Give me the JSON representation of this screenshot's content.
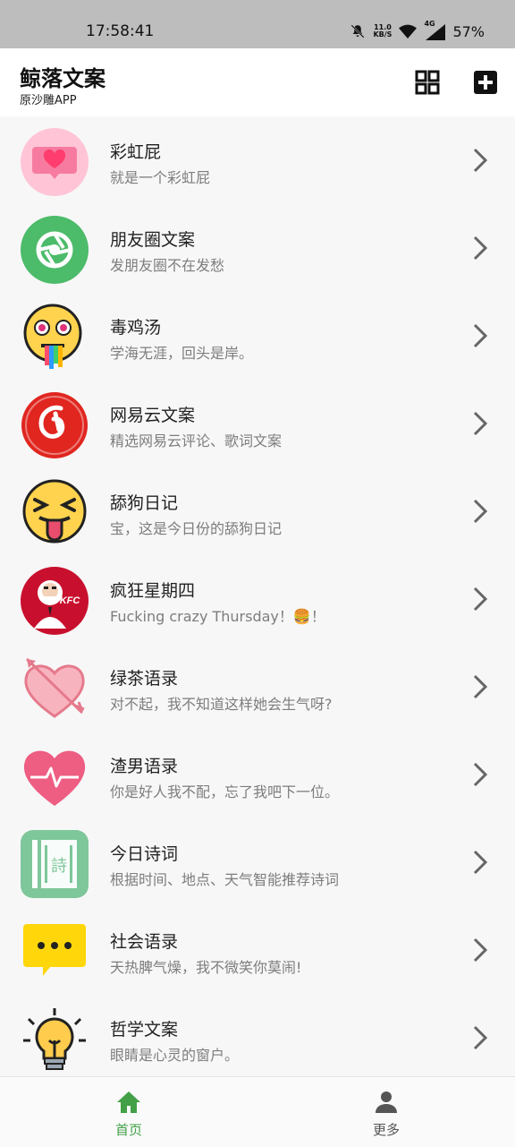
{
  "status": {
    "time": "17:58:41",
    "speed_value": "11.0",
    "speed_unit": "KB/S",
    "network": "4G",
    "battery": "57%"
  },
  "header": {
    "title": "鲸落文案",
    "subtitle": "原沙雕APP"
  },
  "items": [
    {
      "title": "彩虹屁",
      "desc": "就是一个彩虹屁"
    },
    {
      "title": "朋友圈文案",
      "desc": "发朋友圈不在发愁"
    },
    {
      "title": "毒鸡汤",
      "desc": "学海无涯，回头是岸。"
    },
    {
      "title": "网易云文案",
      "desc": "精选网易云评论、歌词文案"
    },
    {
      "title": "舔狗日记",
      "desc": "宝，这是今日份的舔狗日记"
    },
    {
      "title": "疯狂星期四",
      "desc": "Fucking crazy Thursday！🍔！"
    },
    {
      "title": "绿茶语录",
      "desc": "对不起，我不知道这样她会生气呀?"
    },
    {
      "title": "渣男语录",
      "desc": "你是好人我不配，忘了我吧下一位。"
    },
    {
      "title": "今日诗词",
      "desc": "根据时间、地点、天气智能推荐诗词"
    },
    {
      "title": "社会语录",
      "desc": "天热脾气燥，我不微笑你莫闹!"
    },
    {
      "title": "哲学文案",
      "desc": "眼睛是心灵的窗户。"
    }
  ],
  "icons": {
    "kfc_text": "KFC",
    "poem_char": "詩"
  },
  "nav": {
    "home": "首页",
    "more": "更多"
  },
  "colors": {
    "accent": "#43a047",
    "inactive": "#555555"
  }
}
